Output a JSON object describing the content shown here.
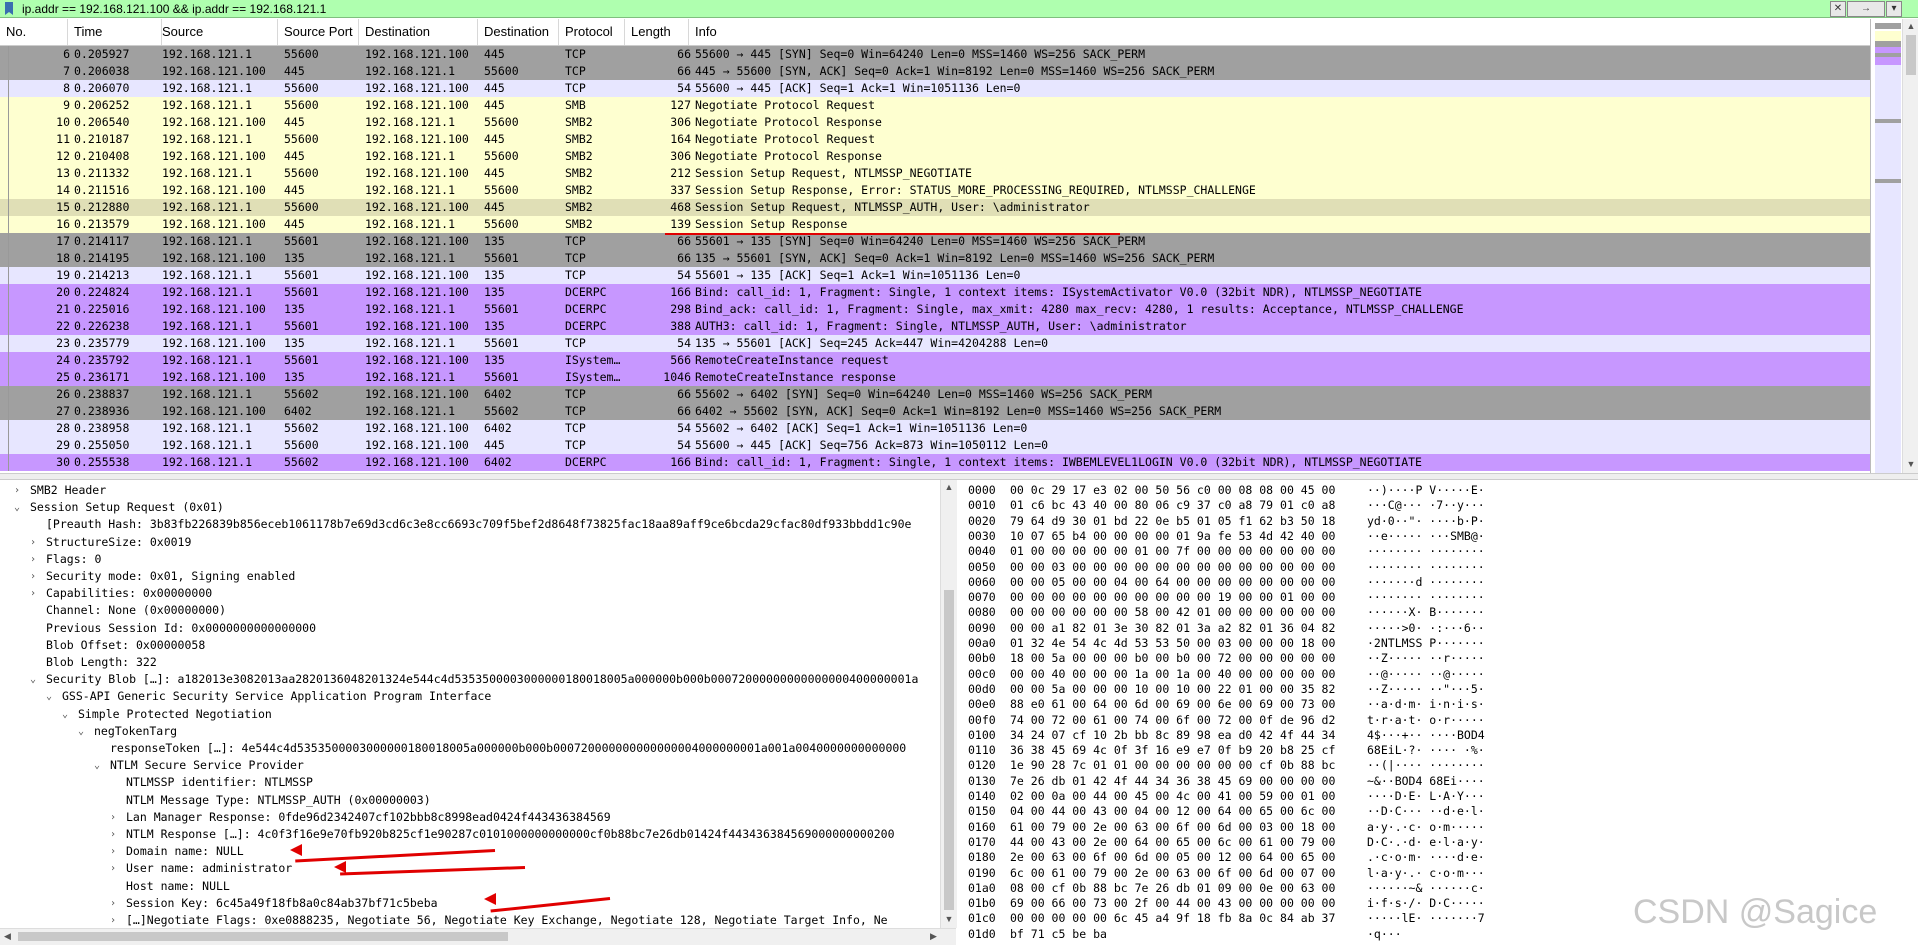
{
  "filter": {
    "text": "ip.addr == 192.168.121.100 && ip.addr == 192.168.121.1",
    "clear": "✕",
    "apply": "→",
    "expr": "▾"
  },
  "columns": [
    "No.",
    "Time",
    "Source",
    "Source Port",
    "Destination",
    "Destination",
    "Protocol",
    "Length",
    "Info"
  ],
  "colors": {
    "tcp_syn": "#a0a0a0",
    "tcp": "#e7e6ff",
    "smb": "#feffd0",
    "dcerpc": "#c797ff",
    "selected": "#e0dfb6"
  },
  "packets": [
    {
      "no": "6",
      "time": "0.205927",
      "src": "192.168.121.1",
      "sport": "55600",
      "dst": "192.168.121.100",
      "dport": "445",
      "proto": "TCP",
      "len": "66",
      "info": "55600 → 445 [SYN] Seq=0 Win=64240 Len=0 MSS=1460 WS=256 SACK_PERM",
      "color": "#a0a0a0"
    },
    {
      "no": "7",
      "time": "0.206038",
      "src": "192.168.121.100",
      "sport": "445",
      "dst": "192.168.121.1",
      "dport": "55600",
      "proto": "TCP",
      "len": "66",
      "info": "445 → 55600 [SYN, ACK] Seq=0 Ack=1 Win=8192 Len=0 MSS=1460 WS=256 SACK_PERM",
      "color": "#a0a0a0"
    },
    {
      "no": "8",
      "time": "0.206070",
      "src": "192.168.121.1",
      "sport": "55600",
      "dst": "192.168.121.100",
      "dport": "445",
      "proto": "TCP",
      "len": "54",
      "info": "55600 → 445 [ACK] Seq=1 Ack=1 Win=1051136 Len=0",
      "color": "#e7e6ff"
    },
    {
      "no": "9",
      "time": "0.206252",
      "src": "192.168.121.1",
      "sport": "55600",
      "dst": "192.168.121.100",
      "dport": "445",
      "proto": "SMB",
      "len": "127",
      "info": "Negotiate Protocol Request",
      "color": "#feffd0"
    },
    {
      "no": "10",
      "time": "0.206540",
      "src": "192.168.121.100",
      "sport": "445",
      "dst": "192.168.121.1",
      "dport": "55600",
      "proto": "SMB2",
      "len": "306",
      "info": "Negotiate Protocol Response",
      "color": "#feffd0"
    },
    {
      "no": "11",
      "time": "0.210187",
      "src": "192.168.121.1",
      "sport": "55600",
      "dst": "192.168.121.100",
      "dport": "445",
      "proto": "SMB2",
      "len": "164",
      "info": "Negotiate Protocol Request",
      "color": "#feffd0"
    },
    {
      "no": "12",
      "time": "0.210408",
      "src": "192.168.121.100",
      "sport": "445",
      "dst": "192.168.121.1",
      "dport": "55600",
      "proto": "SMB2",
      "len": "306",
      "info": "Negotiate Protocol Response",
      "color": "#feffd0"
    },
    {
      "no": "13",
      "time": "0.211332",
      "src": "192.168.121.1",
      "sport": "55600",
      "dst": "192.168.121.100",
      "dport": "445",
      "proto": "SMB2",
      "len": "212",
      "info": "Session Setup Request, NTLMSSP_NEGOTIATE",
      "color": "#feffd0"
    },
    {
      "no": "14",
      "time": "0.211516",
      "src": "192.168.121.100",
      "sport": "445",
      "dst": "192.168.121.1",
      "dport": "55600",
      "proto": "SMB2",
      "len": "337",
      "info": "Session Setup Response, Error: STATUS_MORE_PROCESSING_REQUIRED, NTLMSSP_CHALLENGE",
      "color": "#feffd0"
    },
    {
      "no": "15",
      "time": "0.212880",
      "src": "192.168.121.1",
      "sport": "55600",
      "dst": "192.168.121.100",
      "dport": "445",
      "proto": "SMB2",
      "len": "468",
      "info": "Session Setup Request, NTLMSSP_AUTH, User: \\administrator",
      "color": "#e0dfb6"
    },
    {
      "no": "16",
      "time": "0.213579",
      "src": "192.168.121.100",
      "sport": "445",
      "dst": "192.168.121.1",
      "dport": "55600",
      "proto": "SMB2",
      "len": "139",
      "info": "Session Setup Response",
      "color": "#feffd0"
    },
    {
      "no": "17",
      "time": "0.214117",
      "src": "192.168.121.1",
      "sport": "55601",
      "dst": "192.168.121.100",
      "dport": "135",
      "proto": "TCP",
      "len": "66",
      "info": "55601 → 135 [SYN] Seq=0 Win=64240 Len=0 MSS=1460 WS=256 SACK_PERM",
      "color": "#a0a0a0"
    },
    {
      "no": "18",
      "time": "0.214195",
      "src": "192.168.121.100",
      "sport": "135",
      "dst": "192.168.121.1",
      "dport": "55601",
      "proto": "TCP",
      "len": "66",
      "info": "135 → 55601 [SYN, ACK] Seq=0 Ack=1 Win=8192 Len=0 MSS=1460 WS=256 SACK_PERM",
      "color": "#a0a0a0"
    },
    {
      "no": "19",
      "time": "0.214213",
      "src": "192.168.121.1",
      "sport": "55601",
      "dst": "192.168.121.100",
      "dport": "135",
      "proto": "TCP",
      "len": "54",
      "info": "55601 → 135 [ACK] Seq=1 Ack=1 Win=1051136 Len=0",
      "color": "#e7e6ff"
    },
    {
      "no": "20",
      "time": "0.224824",
      "src": "192.168.121.1",
      "sport": "55601",
      "dst": "192.168.121.100",
      "dport": "135",
      "proto": "DCERPC",
      "len": "166",
      "info": "Bind: call_id: 1, Fragment: Single, 1 context items: ISystemActivator V0.0 (32bit NDR), NTLMSSP_NEGOTIATE",
      "color": "#c797ff"
    },
    {
      "no": "21",
      "time": "0.225016",
      "src": "192.168.121.100",
      "sport": "135",
      "dst": "192.168.121.1",
      "dport": "55601",
      "proto": "DCERPC",
      "len": "298",
      "info": "Bind_ack: call_id: 1, Fragment: Single, max_xmit: 4280 max_recv: 4280, 1 results: Acceptance, NTLMSSP_CHALLENGE",
      "color": "#c797ff"
    },
    {
      "no": "22",
      "time": "0.226238",
      "src": "192.168.121.1",
      "sport": "55601",
      "dst": "192.168.121.100",
      "dport": "135",
      "proto": "DCERPC",
      "len": "388",
      "info": "AUTH3: call_id: 1, Fragment: Single, NTLMSSP_AUTH, User: \\administrator",
      "color": "#c797ff"
    },
    {
      "no": "23",
      "time": "0.235779",
      "src": "192.168.121.100",
      "sport": "135",
      "dst": "192.168.121.1",
      "dport": "55601",
      "proto": "TCP",
      "len": "54",
      "info": "135 → 55601 [ACK] Seq=245 Ack=447 Win=4204288 Len=0",
      "color": "#e7e6ff"
    },
    {
      "no": "24",
      "time": "0.235792",
      "src": "192.168.121.1",
      "sport": "55601",
      "dst": "192.168.121.100",
      "dport": "135",
      "proto": "ISystem…",
      "len": "566",
      "info": "RemoteCreateInstance request",
      "color": "#c797ff"
    },
    {
      "no": "25",
      "time": "0.236171",
      "src": "192.168.121.100",
      "sport": "135",
      "dst": "192.168.121.1",
      "dport": "55601",
      "proto": "ISystem…",
      "len": "1046",
      "info": "RemoteCreateInstance response",
      "color": "#c797ff"
    },
    {
      "no": "26",
      "time": "0.238837",
      "src": "192.168.121.1",
      "sport": "55602",
      "dst": "192.168.121.100",
      "dport": "6402",
      "proto": "TCP",
      "len": "66",
      "info": "55602 → 6402 [SYN] Seq=0 Win=64240 Len=0 MSS=1460 WS=256 SACK_PERM",
      "color": "#a0a0a0"
    },
    {
      "no": "27",
      "time": "0.238936",
      "src": "192.168.121.100",
      "sport": "6402",
      "dst": "192.168.121.1",
      "dport": "55602",
      "proto": "TCP",
      "len": "66",
      "info": "6402 → 55602 [SYN, ACK] Seq=0 Ack=1 Win=8192 Len=0 MSS=1460 WS=256 SACK_PERM",
      "color": "#a0a0a0"
    },
    {
      "no": "28",
      "time": "0.238958",
      "src": "192.168.121.1",
      "sport": "55602",
      "dst": "192.168.121.100",
      "dport": "6402",
      "proto": "TCP",
      "len": "54",
      "info": "55602 → 6402 [ACK] Seq=1 Ack=1 Win=1051136 Len=0",
      "color": "#e7e6ff"
    },
    {
      "no": "29",
      "time": "0.255050",
      "src": "192.168.121.1",
      "sport": "55600",
      "dst": "192.168.121.100",
      "dport": "445",
      "proto": "TCP",
      "len": "54",
      "info": "55600 → 445 [ACK] Seq=756 Ack=873 Win=1050112 Len=0",
      "color": "#e7e6ff"
    },
    {
      "no": "30",
      "time": "0.255538",
      "src": "192.168.121.1",
      "sport": "55602",
      "dst": "192.168.121.100",
      "dport": "6402",
      "proto": "DCERPC",
      "len": "166",
      "info": "Bind: call_id: 1, Fragment: Single, 1 context items: IWBEMLEVEL1LOGIN V0.0 (32bit NDR), NTLMSSP_NEGOTIATE",
      "color": "#c797ff"
    }
  ],
  "tree": [
    {
      "level": 1,
      "arrow": "collapsed",
      "text": "SMB2 Header"
    },
    {
      "level": 1,
      "arrow": "expanded",
      "text": "Session Setup Request (0x01)"
    },
    {
      "level": 2,
      "arrow": "none",
      "text": "[Preauth Hash: 3b83fb226839b856eceb1061178b7e69d3cd6c3e8cc6693c709f5bef2d8648f73825fac18aa89aff9ce6bcda29cfac80df933bbdd1c90e"
    },
    {
      "level": 2,
      "arrow": "collapsed",
      "text": "StructureSize: 0x0019"
    },
    {
      "level": 2,
      "arrow": "collapsed",
      "text": "Flags: 0"
    },
    {
      "level": 2,
      "arrow": "collapsed",
      "text": "Security mode: 0x01, Signing enabled"
    },
    {
      "level": 2,
      "arrow": "collapsed",
      "text": "Capabilities: 0x00000000"
    },
    {
      "level": 2,
      "arrow": "none",
      "text": "Channel: None (0x00000000)"
    },
    {
      "level": 2,
      "arrow": "none",
      "text": "Previous Session Id: 0x0000000000000000"
    },
    {
      "level": 2,
      "arrow": "none",
      "text": "Blob Offset: 0x00000058"
    },
    {
      "level": 2,
      "arrow": "none",
      "text": "Blob Length: 322"
    },
    {
      "level": 2,
      "arrow": "expanded",
      "text": "Security Blob […]: a182013e3082013aa2820136048201324e544c4d5353500003000000180018005a000000b000b00072000000000000000400000001a"
    },
    {
      "level": 3,
      "arrow": "expanded",
      "text": "GSS-API Generic Security Service Application Program Interface"
    },
    {
      "level": 4,
      "arrow": "expanded",
      "text": "Simple Protected Negotiation"
    },
    {
      "level": 5,
      "arrow": "expanded",
      "text": "negTokenTarg"
    },
    {
      "level": 6,
      "arrow": "none",
      "text": "responseToken […]: 4e544c4d5353500003000000180018005a000000b000b000720000000000000004000000001a001a0040000000000000"
    },
    {
      "level": 6,
      "arrow": "expanded",
      "text": "NTLM Secure Service Provider"
    },
    {
      "level": 7,
      "arrow": "none",
      "text": "NTLMSSP identifier: NTLMSSP"
    },
    {
      "level": 7,
      "arrow": "none",
      "text": "NTLM Message Type: NTLMSSP_AUTH (0x00000003)"
    },
    {
      "level": 7,
      "arrow": "collapsed",
      "text": "Lan Manager Response: 0fde96d2342407cf102bbb8c8998ead0424f443436384569"
    },
    {
      "level": 7,
      "arrow": "collapsed",
      "text": "NTLM Response […]: 4c0f3f16e9e70fb920b825cf1e90287c0101000000000000cf0b88bc7e26db01424f443436384569000000000200"
    },
    {
      "level": 7,
      "arrow": "collapsed",
      "text": "Domain name: NULL"
    },
    {
      "level": 7,
      "arrow": "collapsed",
      "text": "User name: administrator"
    },
    {
      "level": 7,
      "arrow": "none",
      "text": "Host name: NULL"
    },
    {
      "level": 7,
      "arrow": "collapsed",
      "text": "Session Key: 6c45a49f18fb8a0c84ab37bf71c5beba"
    },
    {
      "level": 7,
      "arrow": "collapsed",
      "text": "[…]Negotiate Flags: 0xe0888235, Negotiate 56, Negotiate Key Exchange, Negotiate 128, Negotiate Target Info, Ne"
    }
  ],
  "hex": [
    {
      "off": "0000",
      "hex": "00 0c 29 17 e3 02 00 50  56 c0 00 08 08 00 45 00",
      "ascii": "··)····P V·····E·"
    },
    {
      "off": "0010",
      "hex": "01 c6 bc 43 40 00 80 06  c9 37 c0 a8 79 01 c0 a8",
      "ascii": "···C@··· ·7··y···"
    },
    {
      "off": "0020",
      "hex": "79 64 d9 30 01 bd 22 0e  b5 01 05 f1 62 b3 50 18",
      "ascii": "yd·0··\"· ····b·P·"
    },
    {
      "off": "0030",
      "hex": "10 07 65 b4 00 00 00 00  01 9a fe 53 4d 42 40 00",
      "ascii": "··e····· ···SMB@·"
    },
    {
      "off": "0040",
      "hex": "01 00 00 00 00 00 01 00  7f 00 00 00 00 00 00 00",
      "ascii": "········ ········"
    },
    {
      "off": "0050",
      "hex": "00 00 03 00 00 00 00 00  00 00 00 00 00 00 00 00",
      "ascii": "········ ········"
    },
    {
      "off": "0060",
      "hex": "00 00 05 00 00 04 00 64  00 00 00 00 00 00 00 00",
      "ascii": "·······d ········"
    },
    {
      "off": "0070",
      "hex": "00 00 00 00 00 00 00 00  00 00 19 00 00 01 00 00",
      "ascii": "········ ········"
    },
    {
      "off": "0080",
      "hex": "00 00 00 00 00 00 58 00  42 01 00 00 00 00 00 00",
      "ascii": "······X· B·······"
    },
    {
      "off": "0090",
      "hex": "00 00 a1 82 01 3e 30 82  01 3a a2 82 01 36 04 82",
      "ascii": "·····>0· ·:···6··"
    },
    {
      "off": "00a0",
      "hex": "01 32 4e 54 4c 4d 53 53  50 00 03 00 00 00 18 00",
      "ascii": "·2NTLMSS P·······"
    },
    {
      "off": "00b0",
      "hex": "18 00 5a 00 00 00 b0 00  b0 00 72 00 00 00 00 00",
      "ascii": "··Z····· ··r·····"
    },
    {
      "off": "00c0",
      "hex": "00 00 40 00 00 00 1a 00  1a 00 40 00 00 00 00 00",
      "ascii": "··@····· ··@·····"
    },
    {
      "off": "00d0",
      "hex": "00 00 5a 00 00 00 10 00  10 00 22 01 00 00 35 82",
      "ascii": "··Z····· ··\"···5·"
    },
    {
      "off": "00e0",
      "hex": "88 e0 61 00 64 00 6d 00  69 00 6e 00 69 00 73 00",
      "ascii": "··a·d·m· i·n·i·s·"
    },
    {
      "off": "00f0",
      "hex": "74 00 72 00 61 00 74 00  6f 00 72 00 0f de 96 d2",
      "ascii": "t·r·a·t· o·r·····"
    },
    {
      "off": "0100",
      "hex": "34 24 07 cf 10 2b bb 8c  89 98 ea d0 42 4f 44 34",
      "ascii": "4$···+·· ····BOD4"
    },
    {
      "off": "0110",
      "hex": "36 38 45 69 4c 0f 3f 16  e9 e7 0f b9 20 b8 25 cf",
      "ascii": "68EiL·?· ···· ·%·"
    },
    {
      "off": "0120",
      "hex": "1e 90 28 7c 01 01 00 00  00 00 00 00 cf 0b 88 bc",
      "ascii": "··(|···· ········"
    },
    {
      "off": "0130",
      "hex": "7e 26 db 01 42 4f 44 34  36 38 45 69 00 00 00 00",
      "ascii": "~&··BOD4 68Ei····"
    },
    {
      "off": "0140",
      "hex": "02 00 0a 00 44 00 45 00  4c 00 41 00 59 00 01 00",
      "ascii": "····D·E· L·A·Y···"
    },
    {
      "off": "0150",
      "hex": "04 00 44 00 43 00 04 00  12 00 64 00 65 00 6c 00",
      "ascii": "··D·C··· ··d·e·l·"
    },
    {
      "off": "0160",
      "hex": "61 00 79 00 2e 00 63 00  6f 00 6d 00 03 00 18 00",
      "ascii": "a·y·.·c· o·m·····"
    },
    {
      "off": "0170",
      "hex": "44 00 43 00 2e 00 64 00  65 00 6c 00 61 00 79 00",
      "ascii": "D·C·.·d· e·l·a·y·"
    },
    {
      "off": "0180",
      "hex": "2e 00 63 00 6f 00 6d 00  05 00 12 00 64 00 65 00",
      "ascii": ".·c·o·m· ····d·e·"
    },
    {
      "off": "0190",
      "hex": "6c 00 61 00 79 00 2e 00  63 00 6f 00 6d 00 07 00",
      "ascii": "l·a·y·.· c·o·m···"
    },
    {
      "off": "01a0",
      "hex": "08 00 cf 0b 88 bc 7e 26  db 01 09 00 0e 00 63 00",
      "ascii": "······~& ······c·"
    },
    {
      "off": "01b0",
      "hex": "69 00 66 00 73 00 2f 00  44 00 43 00 00 00 00 00",
      "ascii": "i·f·s·/· D·C·····"
    },
    {
      "off": "01c0",
      "hex": "00 00 00 00 00 6c 45 a4  9f 18 fb 8a 0c 84 ab 37",
      "ascii": "·····lE· ·······7"
    },
    {
      "off": "01d0",
      "hex": "bf 71 c5 be ba",
      "ascii": "·q···"
    }
  ],
  "watermark": "CSDN @Sagice"
}
